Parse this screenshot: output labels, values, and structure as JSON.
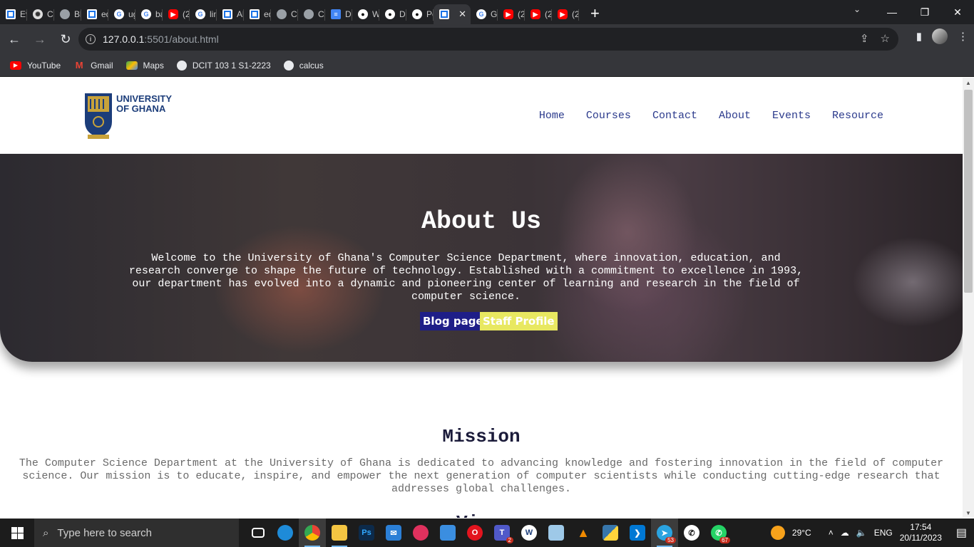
{
  "browser": {
    "tabs": [
      {
        "label": "Ev",
        "icon": "document-icon"
      },
      {
        "label": "Ch",
        "icon": "chatgpt-icon"
      },
      {
        "label": "Bl",
        "icon": "globe-icon"
      },
      {
        "label": "ed",
        "icon": "document-icon"
      },
      {
        "label": "ug",
        "icon": "google-icon"
      },
      {
        "label": "ba",
        "icon": "google-icon"
      },
      {
        "label": "(2!",
        "icon": "youtube-icon"
      },
      {
        "label": "lin",
        "icon": "google-icon"
      },
      {
        "label": "Ab",
        "icon": "document-icon"
      },
      {
        "label": "ed",
        "icon": "document-icon"
      },
      {
        "label": "Cc",
        "icon": "globe-icon"
      },
      {
        "label": "CA",
        "icon": "globe-icon"
      },
      {
        "label": "DC",
        "icon": "google-docs-icon"
      },
      {
        "label": "W",
        "icon": "github-icon"
      },
      {
        "label": "De",
        "icon": "github-icon"
      },
      {
        "label": "Pe",
        "icon": "github-icon"
      },
      {
        "label": "",
        "icon": "document-icon",
        "active": true
      },
      {
        "label": "Gc",
        "icon": "google-icon"
      },
      {
        "label": "(2!",
        "icon": "youtube-icon"
      },
      {
        "label": "(2!",
        "icon": "youtube-icon"
      },
      {
        "label": "(2",
        "icon": "youtube-icon"
      }
    ],
    "url_host": "127.0.0.1",
    "url_path": ":5501/about.html",
    "bookmarks": [
      {
        "label": "YouTube",
        "icon": "youtube-icon"
      },
      {
        "label": "Gmail",
        "icon": "gmail-icon"
      },
      {
        "label": "Maps",
        "icon": "maps-icon"
      },
      {
        "label": "DCIT 103 1 S1-2223",
        "icon": "globe-icon"
      },
      {
        "label": "calcus",
        "icon": "globe-icon"
      }
    ]
  },
  "site": {
    "logo_line1": "UNIVERSITY",
    "logo_line2": "OF GHANA",
    "nav": [
      "Home",
      "Courses",
      "Contact",
      "About",
      "Events",
      "Resource"
    ],
    "hero": {
      "title": "About Us",
      "text": "Welcome to the University of Ghana's Computer Science Department, where innovation, education, and research converge to shape the future of technology. Established with a commitment to excellence in 1993, our department has evolved into a dynamic and pioneering center of learning and research in the field of computer science.",
      "blog_button": "Blog page",
      "staff_button": "Staff Profile"
    },
    "mission": {
      "title": "Mission",
      "text": "The Computer Science Department at the University of Ghana is dedicated to advancing knowledge and fostering innovation in the field of computer science. Our mission is to educate, inspire, and empower the next generation of computer scientists while conducting cutting-edge research that addresses global challenges."
    }
  },
  "taskbar": {
    "search_placeholder": "Type here to search",
    "teams_badge": "2",
    "telegram_badge": "53",
    "whatsapp_badge": "67",
    "weather": "29°C",
    "language": "ENG",
    "time": "17:54",
    "date": "20/11/2023"
  },
  "colors": {
    "nav_link": "#2b3a8c",
    "blog_button_bg": "#1e1e88",
    "staff_button_bg": "#e8e861"
  }
}
